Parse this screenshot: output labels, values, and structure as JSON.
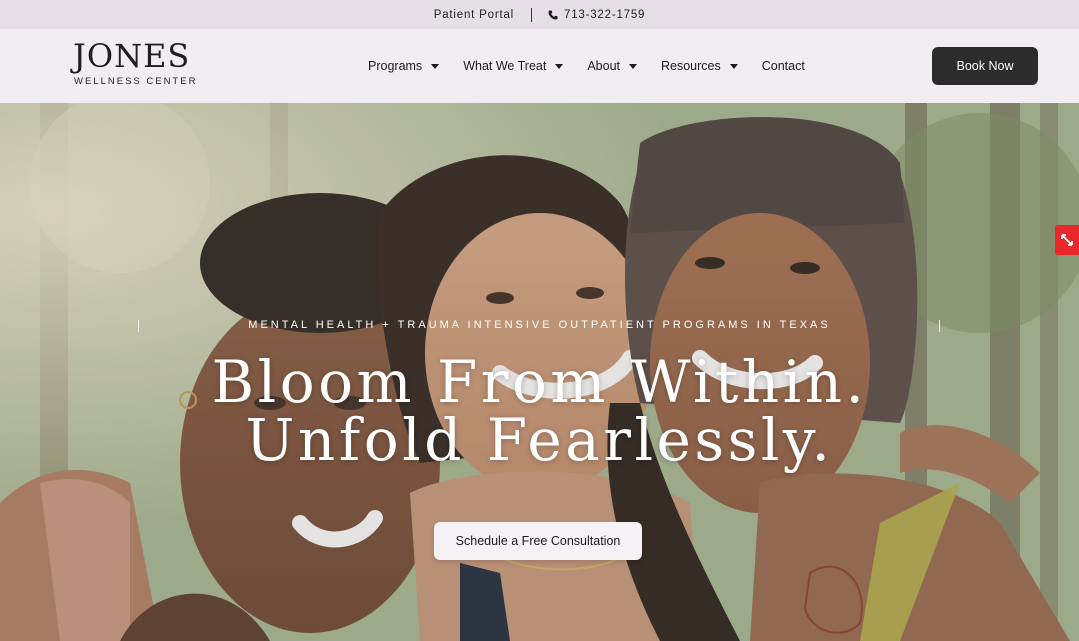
{
  "topbar": {
    "portal_label": "Patient Portal",
    "phone": "713-322-1759"
  },
  "header": {
    "logo_word": "JONES",
    "logo_sub": "WELLNESS CENTER",
    "nav": [
      {
        "label": "Programs",
        "dropdown": true
      },
      {
        "label": "What We Treat",
        "dropdown": true
      },
      {
        "label": "About",
        "dropdown": true
      },
      {
        "label": "Resources",
        "dropdown": true
      },
      {
        "label": "Contact",
        "dropdown": false
      }
    ],
    "book_label": "Book Now"
  },
  "hero": {
    "eyebrow": "MENTAL HEALTH + TRAUMA INTENSIVE OUTPATIENT PROGRAMS IN TEXAS",
    "title_line1": "Bloom From Within.",
    "title_line2": "Unfold Fearlessly.",
    "cta_label": "Schedule a Free Consultation"
  },
  "colors": {
    "topbar_bg": "#e4e0e5",
    "header_bg": "#f1eef2",
    "button_dark": "#2c2c2c",
    "badge_red": "#e8282b"
  }
}
